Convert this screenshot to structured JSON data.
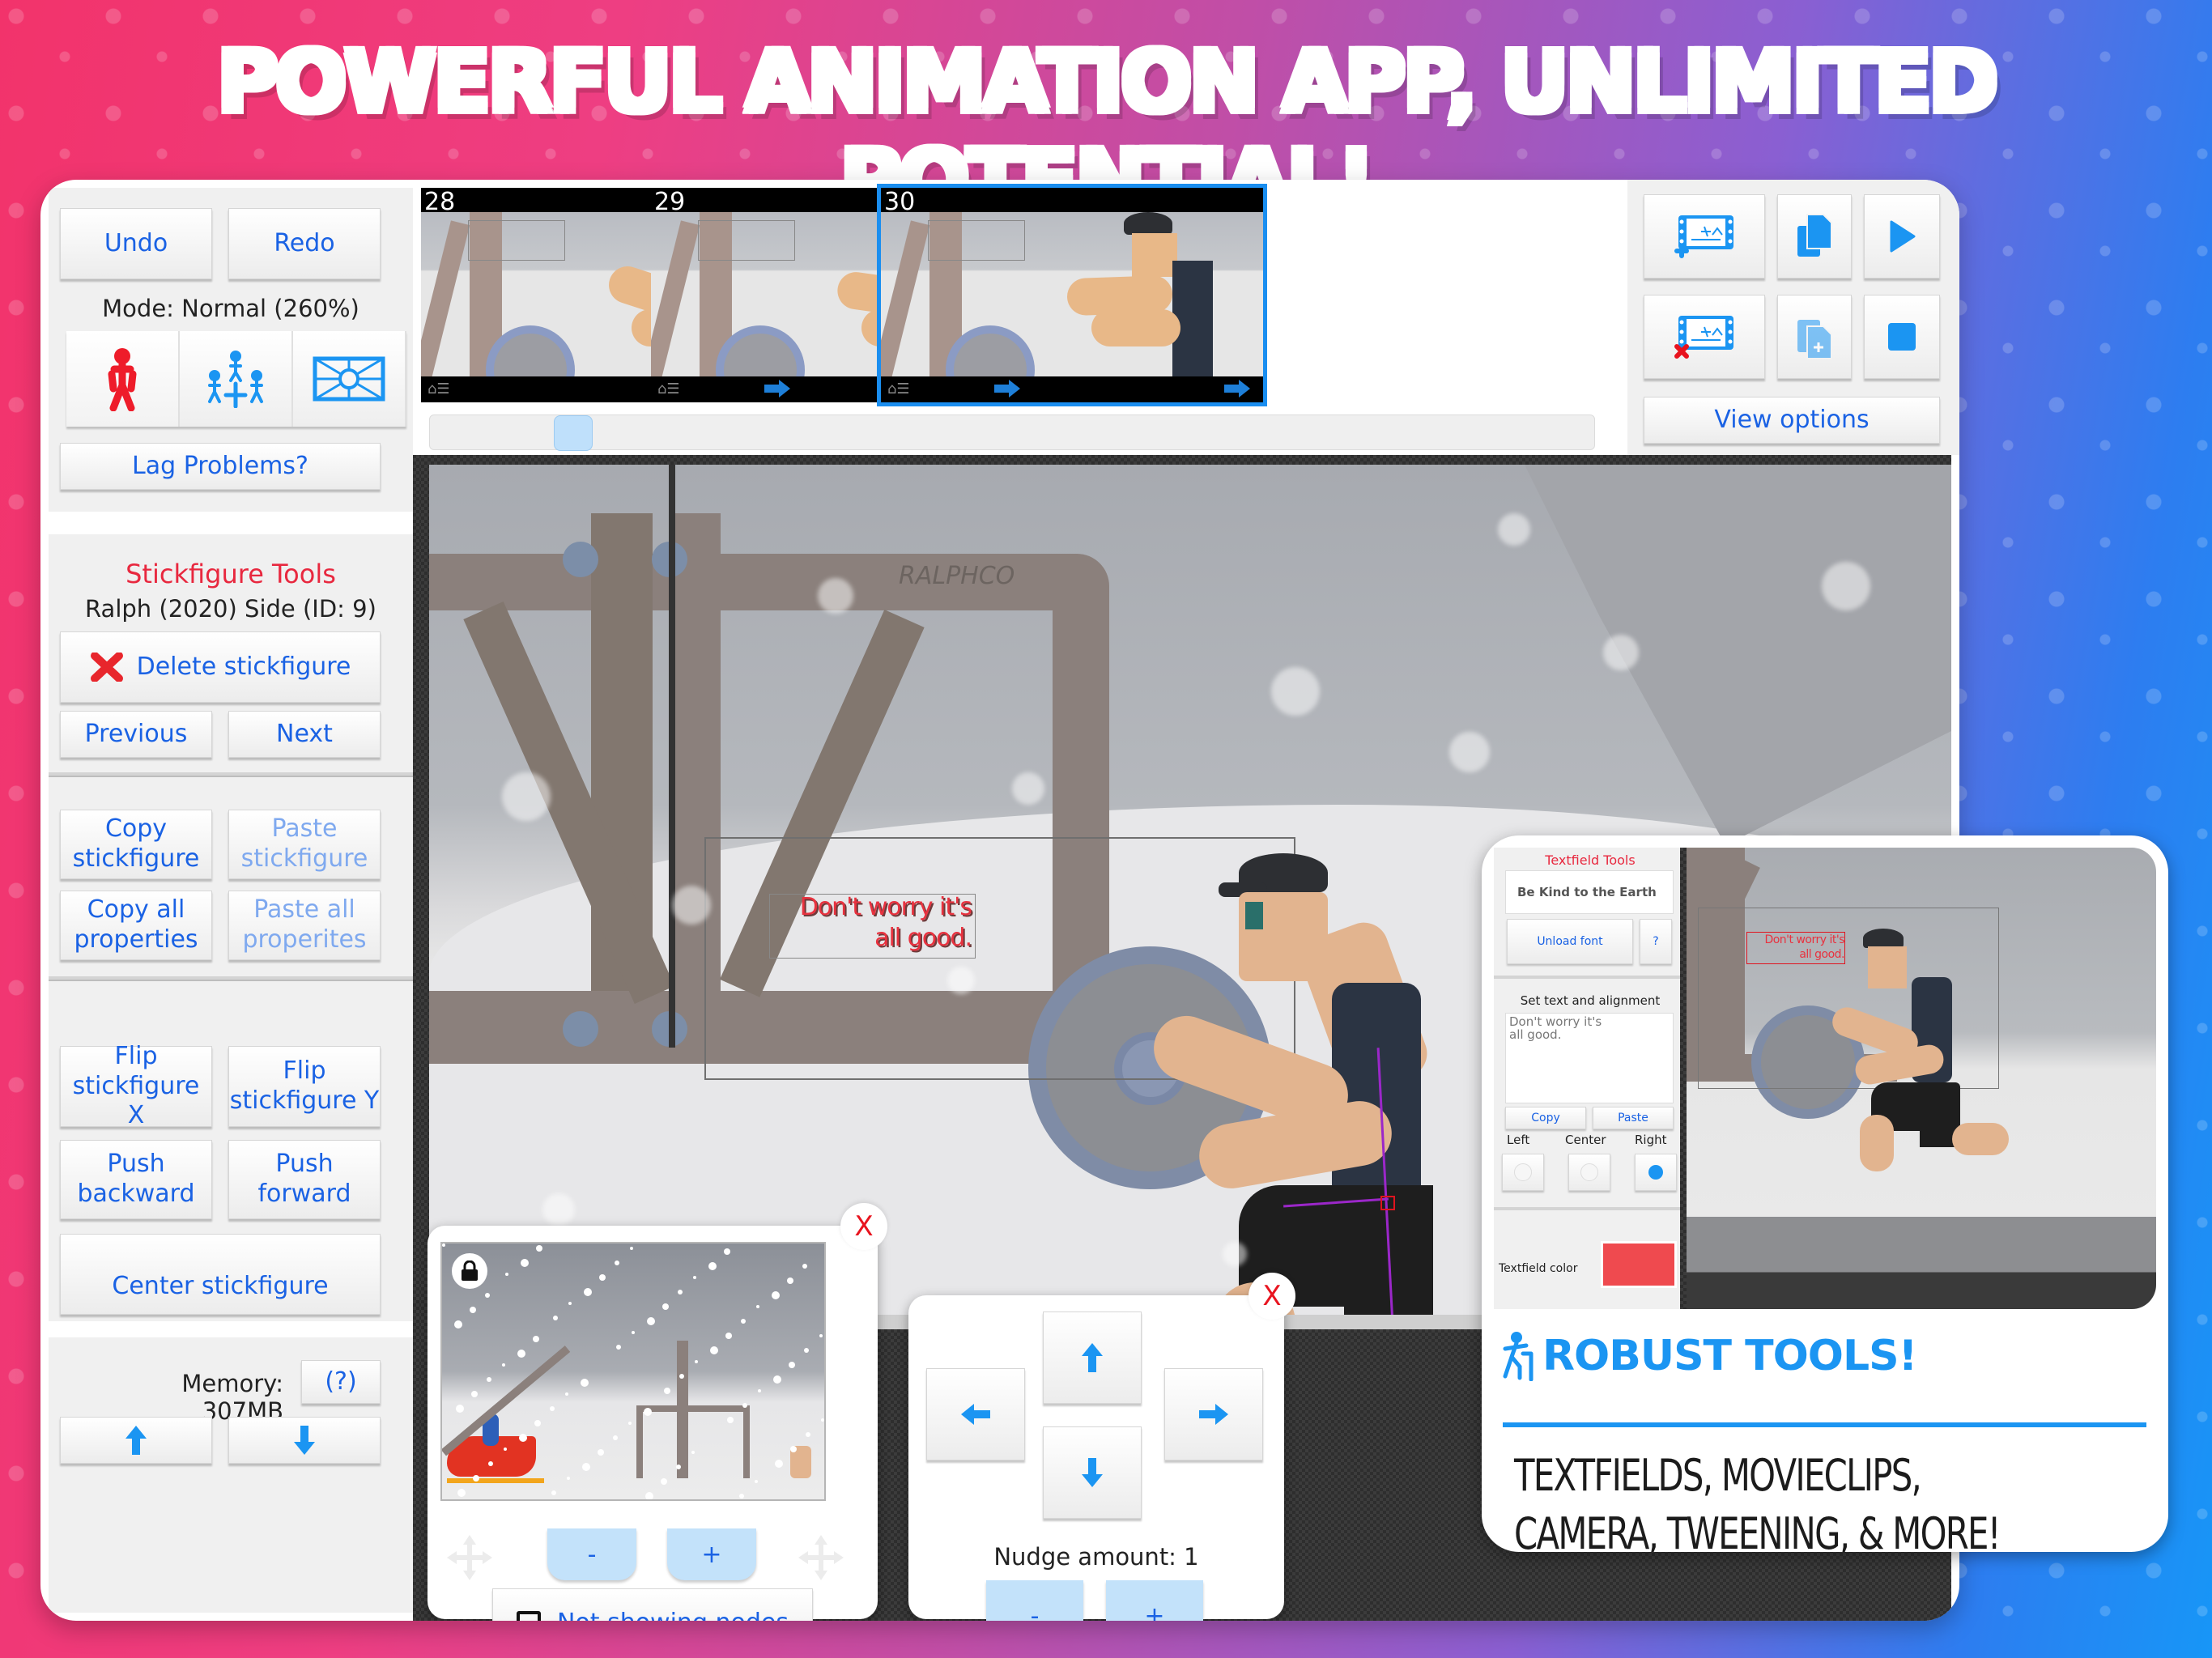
{
  "headline": "POWERFUL ANIMATION APP, UNLIMITED POTENTIAL!",
  "sidebar": {
    "undo_label": "Undo",
    "redo_label": "Redo",
    "mode_text": "Mode: Normal (260%)",
    "mode_buttons": [
      {
        "icon": "stickfigure-icon",
        "active": true
      },
      {
        "icon": "move-group-icon",
        "active": false
      },
      {
        "icon": "camera-frame-icon",
        "active": false
      }
    ],
    "lag_label": "Lag Problems?",
    "tools_title": "Stickfigure Tools",
    "selected_figure": "Ralph (2020) Side (ID: 9)",
    "delete_label": "Delete stickfigure",
    "previous_label": "Previous",
    "next_label": "Next",
    "copy_stickfigure_l1": "Copy",
    "copy_stickfigure_l2": "stickfigure",
    "paste_stickfigure_l1": "Paste",
    "paste_stickfigure_l2": "stickfigure",
    "copy_props_l1": "Copy all",
    "copy_props_l2": "properties",
    "paste_props_l1": "Paste all",
    "paste_props_l2": "properites",
    "flip_x_l1": "Flip",
    "flip_x_l2": "stickfigure X",
    "flip_y_l1": "Flip",
    "flip_y_l2": "stickfigure Y",
    "push_back_l1": "Push",
    "push_back_l2": "backward",
    "push_forward_label": "Push forward",
    "center_label": "Center stickfigure",
    "memory_text": "Memory: 307MB",
    "memory_help_label": "(?)"
  },
  "timeline": {
    "frames": [
      {
        "number": "28",
        "selected": false
      },
      {
        "number": "29",
        "selected": false
      },
      {
        "number": "30",
        "selected": true
      }
    ],
    "scrubber_position": 0.11
  },
  "frame_controls": {
    "add_frame_icon": "add-frame-icon",
    "delete_frame_icon": "delete-frame-icon",
    "copy_icon": "copy-frame-icon",
    "paste_icon": "paste-frame-icon",
    "play_icon": "play-icon",
    "stop_icon": "stop-icon",
    "view_options_label": "View options"
  },
  "canvas": {
    "textfield_line1": "Don't worry it's",
    "textfield_line2": "all good.",
    "watermark": "RALPHCO"
  },
  "preview_popup": {
    "close_label": "X",
    "zoom_out_label": "-",
    "zoom_in_label": "+",
    "nodes_toggle_label": "Not showing nodes",
    "nodes_checked": false
  },
  "nudge_popup": {
    "close_label": "X",
    "nudge_text": "Nudge amount: 1",
    "minus_label": "-",
    "plus_label": "+"
  },
  "inset": {
    "panel_title": "Textfield Tools",
    "font_name": "Be Kind to the Earth",
    "unload_font_label": "Unload font",
    "help_label": "?",
    "set_text_label": "Set text and alignment",
    "textarea_value": "Don't worry it's\nall good.",
    "copy_label": "Copy",
    "paste_label": "Paste",
    "align_left": "Left",
    "align_center": "Center",
    "align_right": "Right",
    "alignment_selected": "Right",
    "textfield_color_label": "Textfield color",
    "textfield_color": "#ef4a4f",
    "preview_text_line1": "Don't worry it's",
    "preview_text_line2": "all good.",
    "robust_title": "ROBUST TOOLS!",
    "robust_line1": "TEXTFIELDS, MOVIECLIPS,",
    "robust_line2": "CAMERA, TWEENING, & MORE!"
  },
  "colors": {
    "accent_blue": "#1a62e4",
    "icon_blue": "#1b95f2",
    "danger_red": "#e8283f",
    "selected_frame": "#1a8ef0"
  }
}
